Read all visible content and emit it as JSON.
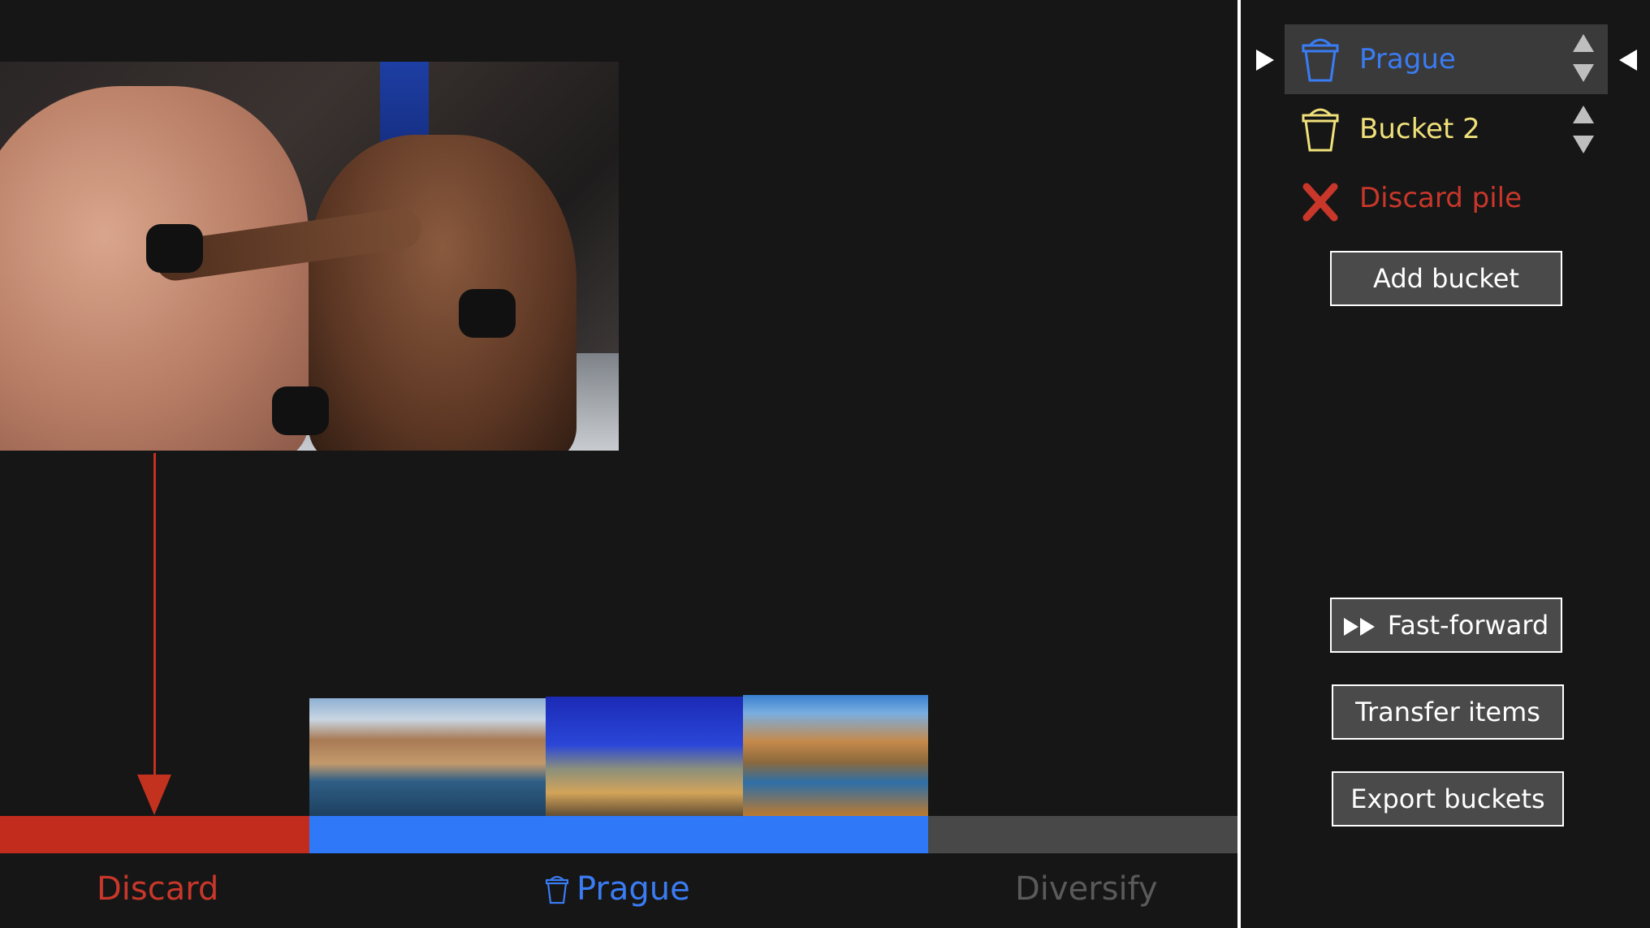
{
  "main": {
    "hero_image": {
      "description": "ufc-fight-photo"
    },
    "thumbnails": [
      {
        "name": "prague-charles-bridge"
      },
      {
        "name": "prague-old-town-night"
      },
      {
        "name": "prague-bridges-autumn"
      }
    ],
    "bottom_labels": {
      "discard": "Discard",
      "prague": "Prague",
      "diversify": "Diversify"
    },
    "colors": {
      "discard": "#c12c1d",
      "prague": "#2f78f7",
      "diversify": "#484848"
    }
  },
  "sidebar": {
    "buckets": [
      {
        "label": "Prague",
        "color": "#3a7cf4",
        "selected": true
      },
      {
        "label": "Bucket 2",
        "color": "#efe07a",
        "selected": false
      }
    ],
    "discard_label": "Discard pile",
    "buttons": {
      "add_bucket": "Add bucket",
      "fast_forward": "Fast-forward",
      "transfer_items": "Transfer items",
      "export_buckets": "Export buckets"
    }
  }
}
